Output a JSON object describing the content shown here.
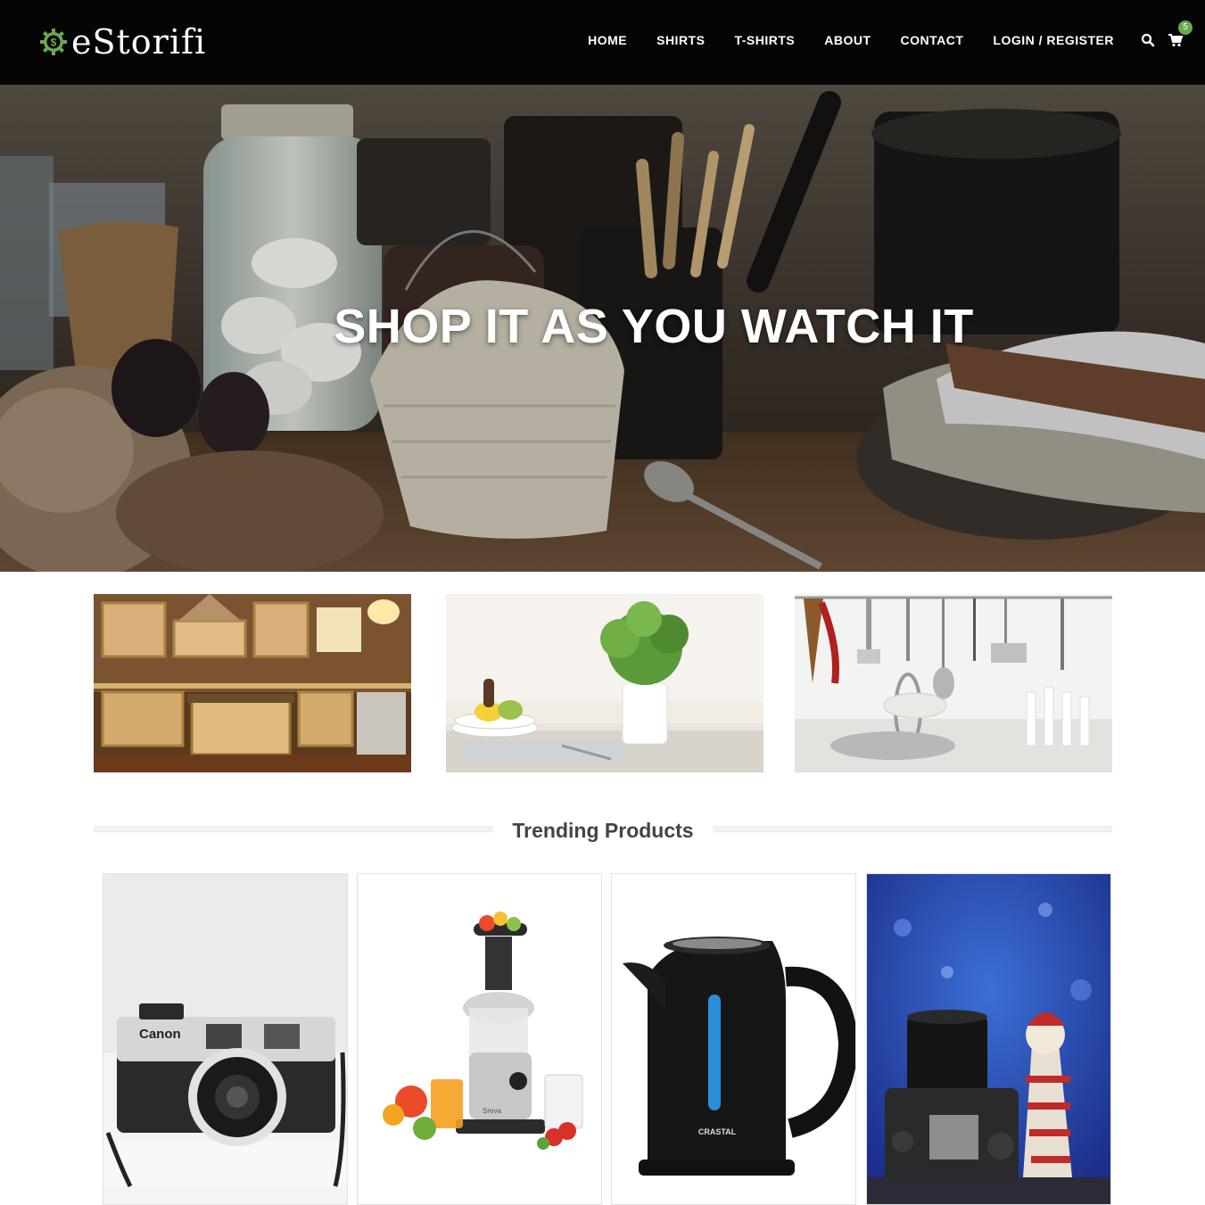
{
  "brand": {
    "name": "eStorifi",
    "accent": "#6aa84f"
  },
  "nav": {
    "items": [
      "HOME",
      "SHIRTS",
      "T-SHIRTS",
      "ABOUT",
      "CONTACT",
      "LOGIN / REGISTER"
    ],
    "search_icon": "search-icon",
    "cart_icon": "cart-icon",
    "cart_count": "5"
  },
  "hero": {
    "title": "SHOP IT AS YOU WATCH IT"
  },
  "categories": [
    {
      "icon": "kitchen-image"
    },
    {
      "icon": "dining-table-image"
    },
    {
      "icon": "kitchen-utensils-image"
    }
  ],
  "trending": {
    "title": "Trending Products",
    "products": [
      {
        "brand_label": "Canon"
      },
      {
        "brand_label": "Sreva"
      },
      {
        "brand_label": "CRASTAL"
      },
      {
        "brand_label": ""
      }
    ]
  }
}
